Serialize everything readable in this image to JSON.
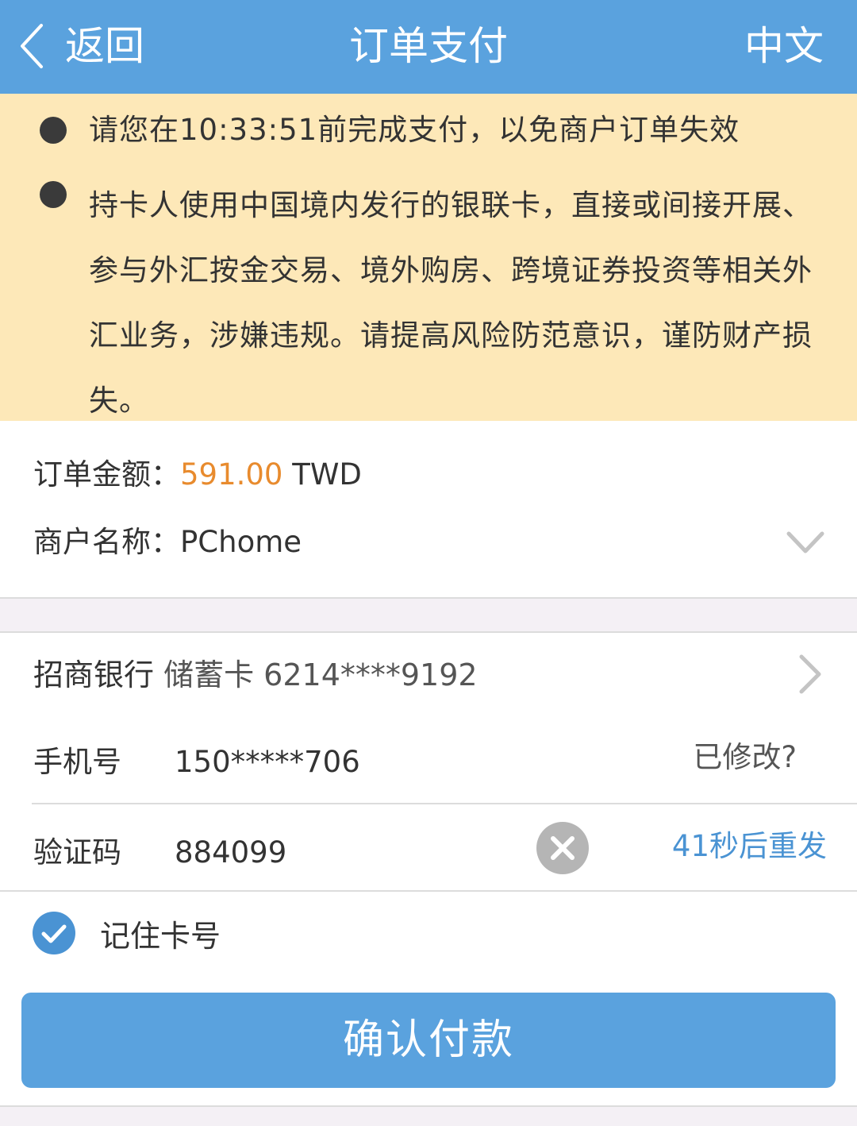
{
  "header": {
    "back_label": "返回",
    "title": "订单支付",
    "lang_label": "中文"
  },
  "notice": {
    "line1": "请您在10:33:51前完成支付，以免商户订单失效",
    "line2": "持卡人使用中国境内发行的银联卡，直接或间接开展、参与外汇按金交易、境外购房、跨境证券投资等相关外汇业务，涉嫌违规。请提高风险防范意识，谨防财产损失。"
  },
  "order": {
    "amount_label": "订单金额：",
    "amount_value": "591.00",
    "currency": " TWD",
    "merchant_label": "商户名称：",
    "merchant_value": "PChome"
  },
  "card": {
    "bank_name": "招商银行",
    "card_info": " 储蓄卡 6214****9192"
  },
  "form": {
    "phone_label": "手机号",
    "phone_value": "150*****706",
    "phone_edit": "已修改?",
    "code_label": "验证码",
    "code_value": "884099",
    "resend_label": "41秒后重发",
    "remember_label": "记住卡号"
  },
  "confirm_label": "确认付款",
  "colors": {
    "header_bg": "#5aa2de",
    "notice_bg": "#fde8b8",
    "amount": "#e88b2e",
    "link": "#4a93d3"
  }
}
